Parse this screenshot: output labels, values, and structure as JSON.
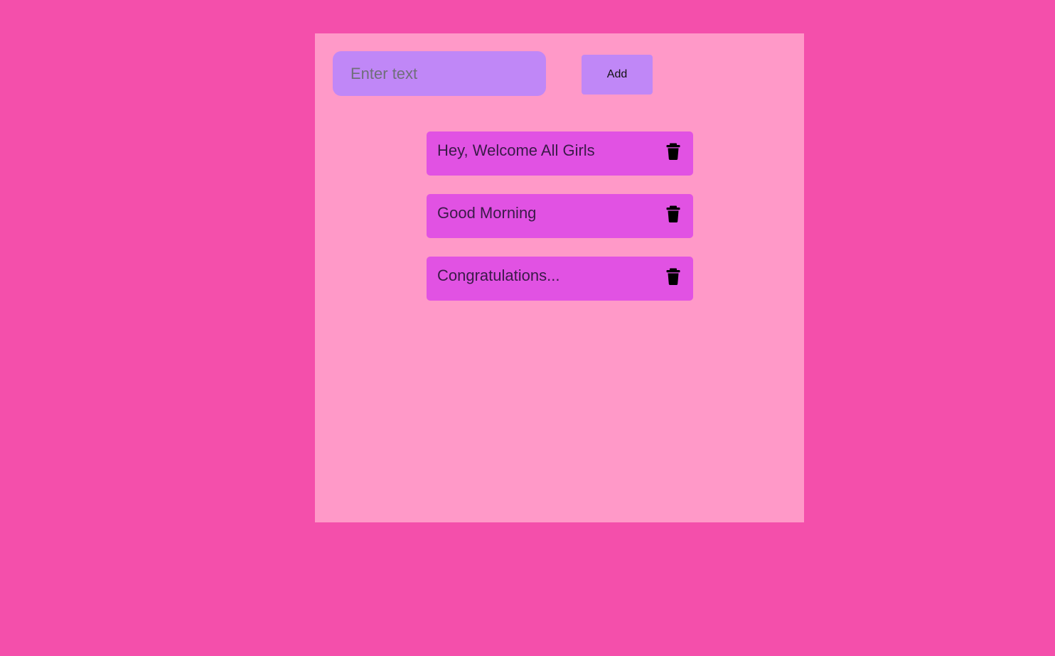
{
  "input": {
    "placeholder": "Enter text",
    "value": ""
  },
  "add_button": {
    "label": "Add"
  },
  "todos": [
    {
      "text": "Hey, Welcome All Girls",
      "icon": "trash-icon"
    },
    {
      "text": "Good Morning",
      "icon": "trash-icon"
    },
    {
      "text": "Congratulations...",
      "icon": "trash-icon"
    }
  ],
  "colors": {
    "page_background": "#f44fab",
    "panel_background": "#ff99c8",
    "input_background": "#c087f7",
    "button_background": "#c087f7",
    "item_background": "#e152e3"
  }
}
